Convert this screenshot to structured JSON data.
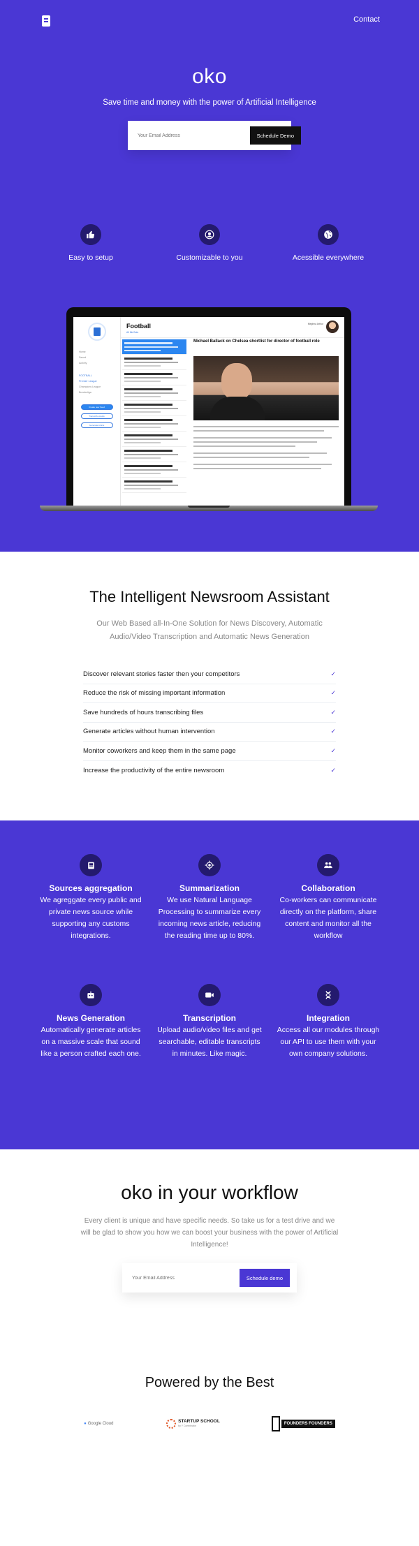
{
  "nav": {
    "logo_icon": "oko-document-icon",
    "contact_label": "Contact"
  },
  "hero": {
    "brand": "oko",
    "tagline": "Save time and money with the power of Artificial Intelligence",
    "email_placeholder": "Your Email Address",
    "cta_label": "Schedule Demo",
    "features": [
      {
        "icon": "thumbs-up-icon",
        "label": "Easy to setup"
      },
      {
        "icon": "user-circle-icon",
        "label": "Customizable to you"
      },
      {
        "icon": "globe-icon",
        "label": "Acessible everywhere"
      }
    ]
  },
  "mockup": {
    "page_title": "Football",
    "tabs": "All  Me  Bots",
    "user_name": "Meghna Arthur",
    "nav_items": [
      "Home",
      "Saved",
      "Activity"
    ],
    "categories": [
      "FOOTBALL",
      "Premier League",
      "Champions League",
      "Bundesliga"
    ],
    "buttons": [
      "Create new Feed",
      "Transcribe Audio",
      "Generate Article"
    ],
    "article_title": "Michael Ballack on Chelsea shortlist for director of football role"
  },
  "assistant": {
    "title": "The Intelligent Newsroom Assistant",
    "subtitle": "Our Web Based all-In-One Solution for News Discovery, Automatic Audio/Video Transcription and Automatic News Generation",
    "checklist": [
      "Discover relevant stories faster then your competitors",
      "Reduce the risk of missing important information",
      "Save hundreds of hours transcribing files",
      "Generate articles without human intervention",
      "Monitor coworkers and keep them in the same page",
      "Increase the productivity of the entire newsroom"
    ],
    "check_icon": "check-icon"
  },
  "modules": [
    {
      "icon": "document-icon",
      "title": "Sources aggregation",
      "text": "We agreggate every public and private news source while supporting any customs integrations."
    },
    {
      "icon": "target-icon",
      "title": "Summarization",
      "text": "We use Natural Language Processing to summarize every incoming news article, reducing the reading time up to 80%."
    },
    {
      "icon": "group-icon",
      "title": "Collaboration",
      "text": "Co-workers can communicate directly on the platform, share content and monitor all the workflow"
    },
    {
      "icon": "robot-icon",
      "title": "News Generation",
      "text": "Automatically generate articles on a massive scale that sound like a person crafted each one."
    },
    {
      "icon": "video-camera-icon",
      "title": "Transcription",
      "text": "Upload audio/video files and get searchable, editable transcripts in minutes. Like magic."
    },
    {
      "icon": "dna-icon",
      "title": "Integration",
      "text": "Access all our modules through our API to use them with your own company solutions."
    }
  ],
  "workflow": {
    "title": "oko in your workflow",
    "subtitle": "Every client is unique and have specific needs. So take us for a test drive and we will be glad to show you how we can boost your business with the power of Artificial Intelligence!",
    "email_placeholder": "Your Email Address",
    "cta_label": "Schedule demo"
  },
  "powered": {
    "title": "Powered by the Best",
    "logos": [
      {
        "name": "Google Cloud",
        "icon": "google-cloud-logo"
      },
      {
        "name": "STARTUP SCHOOL",
        "sub": "by Y Combinator",
        "icon": "startup-school-logo"
      },
      {
        "name": "FOUNDERS FOUNDERS",
        "icon": "founders-founders-logo"
      }
    ]
  },
  "colors": {
    "brand_purple": "#4a37d4",
    "icon_circle": "#241a6e",
    "button_dark": "#111111"
  }
}
